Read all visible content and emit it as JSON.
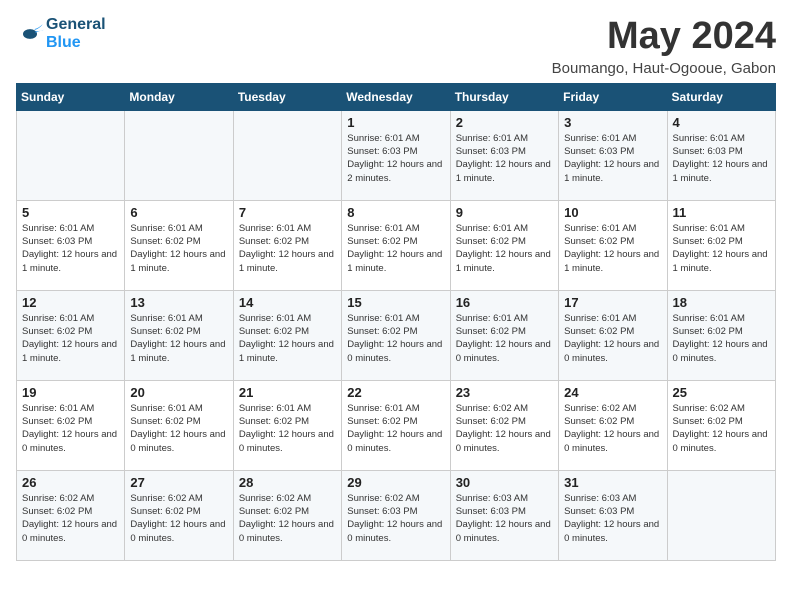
{
  "logo": {
    "text1": "General",
    "text2": "Blue"
  },
  "title": "May 2024",
  "location": "Boumango, Haut-Ogooue, Gabon",
  "weekdays": [
    "Sunday",
    "Monday",
    "Tuesday",
    "Wednesday",
    "Thursday",
    "Friday",
    "Saturday"
  ],
  "weeks": [
    [
      {
        "day": "",
        "sunrise": "",
        "sunset": "",
        "daylight": ""
      },
      {
        "day": "",
        "sunrise": "",
        "sunset": "",
        "daylight": ""
      },
      {
        "day": "",
        "sunrise": "",
        "sunset": "",
        "daylight": ""
      },
      {
        "day": "1",
        "sunrise": "Sunrise: 6:01 AM",
        "sunset": "Sunset: 6:03 PM",
        "daylight": "Daylight: 12 hours and 2 minutes."
      },
      {
        "day": "2",
        "sunrise": "Sunrise: 6:01 AM",
        "sunset": "Sunset: 6:03 PM",
        "daylight": "Daylight: 12 hours and 1 minute."
      },
      {
        "day": "3",
        "sunrise": "Sunrise: 6:01 AM",
        "sunset": "Sunset: 6:03 PM",
        "daylight": "Daylight: 12 hours and 1 minute."
      },
      {
        "day": "4",
        "sunrise": "Sunrise: 6:01 AM",
        "sunset": "Sunset: 6:03 PM",
        "daylight": "Daylight: 12 hours and 1 minute."
      }
    ],
    [
      {
        "day": "5",
        "sunrise": "Sunrise: 6:01 AM",
        "sunset": "Sunset: 6:03 PM",
        "daylight": "Daylight: 12 hours and 1 minute."
      },
      {
        "day": "6",
        "sunrise": "Sunrise: 6:01 AM",
        "sunset": "Sunset: 6:02 PM",
        "daylight": "Daylight: 12 hours and 1 minute."
      },
      {
        "day": "7",
        "sunrise": "Sunrise: 6:01 AM",
        "sunset": "Sunset: 6:02 PM",
        "daylight": "Daylight: 12 hours and 1 minute."
      },
      {
        "day": "8",
        "sunrise": "Sunrise: 6:01 AM",
        "sunset": "Sunset: 6:02 PM",
        "daylight": "Daylight: 12 hours and 1 minute."
      },
      {
        "day": "9",
        "sunrise": "Sunrise: 6:01 AM",
        "sunset": "Sunset: 6:02 PM",
        "daylight": "Daylight: 12 hours and 1 minute."
      },
      {
        "day": "10",
        "sunrise": "Sunrise: 6:01 AM",
        "sunset": "Sunset: 6:02 PM",
        "daylight": "Daylight: 12 hours and 1 minute."
      },
      {
        "day": "11",
        "sunrise": "Sunrise: 6:01 AM",
        "sunset": "Sunset: 6:02 PM",
        "daylight": "Daylight: 12 hours and 1 minute."
      }
    ],
    [
      {
        "day": "12",
        "sunrise": "Sunrise: 6:01 AM",
        "sunset": "Sunset: 6:02 PM",
        "daylight": "Daylight: 12 hours and 1 minute."
      },
      {
        "day": "13",
        "sunrise": "Sunrise: 6:01 AM",
        "sunset": "Sunset: 6:02 PM",
        "daylight": "Daylight: 12 hours and 1 minute."
      },
      {
        "day": "14",
        "sunrise": "Sunrise: 6:01 AM",
        "sunset": "Sunset: 6:02 PM",
        "daylight": "Daylight: 12 hours and 1 minute."
      },
      {
        "day": "15",
        "sunrise": "Sunrise: 6:01 AM",
        "sunset": "Sunset: 6:02 PM",
        "daylight": "Daylight: 12 hours and 0 minutes."
      },
      {
        "day": "16",
        "sunrise": "Sunrise: 6:01 AM",
        "sunset": "Sunset: 6:02 PM",
        "daylight": "Daylight: 12 hours and 0 minutes."
      },
      {
        "day": "17",
        "sunrise": "Sunrise: 6:01 AM",
        "sunset": "Sunset: 6:02 PM",
        "daylight": "Daylight: 12 hours and 0 minutes."
      },
      {
        "day": "18",
        "sunrise": "Sunrise: 6:01 AM",
        "sunset": "Sunset: 6:02 PM",
        "daylight": "Daylight: 12 hours and 0 minutes."
      }
    ],
    [
      {
        "day": "19",
        "sunrise": "Sunrise: 6:01 AM",
        "sunset": "Sunset: 6:02 PM",
        "daylight": "Daylight: 12 hours and 0 minutes."
      },
      {
        "day": "20",
        "sunrise": "Sunrise: 6:01 AM",
        "sunset": "Sunset: 6:02 PM",
        "daylight": "Daylight: 12 hours and 0 minutes."
      },
      {
        "day": "21",
        "sunrise": "Sunrise: 6:01 AM",
        "sunset": "Sunset: 6:02 PM",
        "daylight": "Daylight: 12 hours and 0 minutes."
      },
      {
        "day": "22",
        "sunrise": "Sunrise: 6:01 AM",
        "sunset": "Sunset: 6:02 PM",
        "daylight": "Daylight: 12 hours and 0 minutes."
      },
      {
        "day": "23",
        "sunrise": "Sunrise: 6:02 AM",
        "sunset": "Sunset: 6:02 PM",
        "daylight": "Daylight: 12 hours and 0 minutes."
      },
      {
        "day": "24",
        "sunrise": "Sunrise: 6:02 AM",
        "sunset": "Sunset: 6:02 PM",
        "daylight": "Daylight: 12 hours and 0 minutes."
      },
      {
        "day": "25",
        "sunrise": "Sunrise: 6:02 AM",
        "sunset": "Sunset: 6:02 PM",
        "daylight": "Daylight: 12 hours and 0 minutes."
      }
    ],
    [
      {
        "day": "26",
        "sunrise": "Sunrise: 6:02 AM",
        "sunset": "Sunset: 6:02 PM",
        "daylight": "Daylight: 12 hours and 0 minutes."
      },
      {
        "day": "27",
        "sunrise": "Sunrise: 6:02 AM",
        "sunset": "Sunset: 6:02 PM",
        "daylight": "Daylight: 12 hours and 0 minutes."
      },
      {
        "day": "28",
        "sunrise": "Sunrise: 6:02 AM",
        "sunset": "Sunset: 6:02 PM",
        "daylight": "Daylight: 12 hours and 0 minutes."
      },
      {
        "day": "29",
        "sunrise": "Sunrise: 6:02 AM",
        "sunset": "Sunset: 6:03 PM",
        "daylight": "Daylight: 12 hours and 0 minutes."
      },
      {
        "day": "30",
        "sunrise": "Sunrise: 6:03 AM",
        "sunset": "Sunset: 6:03 PM",
        "daylight": "Daylight: 12 hours and 0 minutes."
      },
      {
        "day": "31",
        "sunrise": "Sunrise: 6:03 AM",
        "sunset": "Sunset: 6:03 PM",
        "daylight": "Daylight: 12 hours and 0 minutes."
      },
      {
        "day": "",
        "sunrise": "",
        "sunset": "",
        "daylight": ""
      }
    ]
  ]
}
